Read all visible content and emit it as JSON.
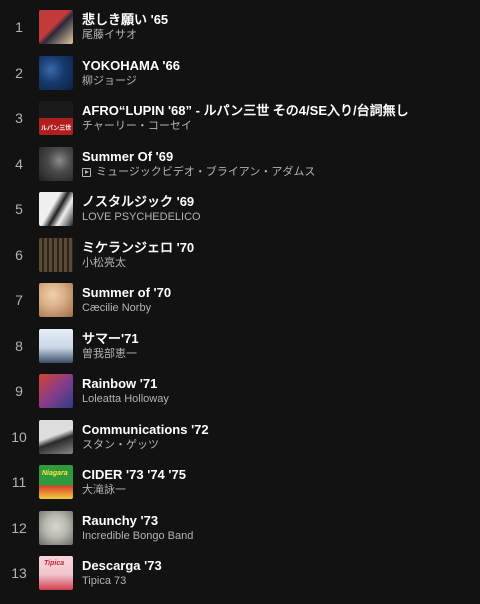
{
  "tracks": [
    {
      "num": "1",
      "title": "悲しき願い '65",
      "artist": "尾藤イサオ",
      "video": false,
      "cover_colors": [
        "#c23a3a",
        "#2a2a3a"
      ]
    },
    {
      "num": "2",
      "title": "YOKOHAMA '66",
      "artist": "柳ジョージ",
      "video": false,
      "cover_colors": [
        "#163a6e",
        "#0b2242"
      ]
    },
    {
      "num": "3",
      "title": "AFRO“LUPIN '68” - ルパン三世 その4/SE入り/台詞無し",
      "artist": "チャーリー・コーセイ",
      "video": false,
      "cover_colors": [
        "#1a1a1a",
        "#b01e1e"
      ]
    },
    {
      "num": "4",
      "title": "Summer Of '69",
      "artist": "ミュージックビデオ・ブライアン・アダムス",
      "video": true,
      "cover_colors": [
        "#4a4a4a",
        "#1f1f1f"
      ]
    },
    {
      "num": "5",
      "title": "ノスタルジック '69",
      "artist": "LOVE PSYCHEDELICO",
      "video": false,
      "cover_colors": [
        "#e8e8e8",
        "#202020"
      ]
    },
    {
      "num": "6",
      "title": "ミケランジェロ '70",
      "artist": "小松亮太",
      "video": false,
      "cover_colors": [
        "#5a4a36",
        "#2b231a"
      ]
    },
    {
      "num": "7",
      "title": "Summer of '70",
      "artist": "Cæcilie Norby",
      "video": false,
      "cover_colors": [
        "#d9b08a",
        "#a06a48"
      ]
    },
    {
      "num": "8",
      "title": "サマー'71",
      "artist": "曽我部恵一",
      "video": false,
      "cover_colors": [
        "#c9d6e6",
        "#3c4e66"
      ]
    },
    {
      "num": "9",
      "title": "Rainbow '71",
      "artist": "Loleatta Holloway",
      "video": false,
      "cover_colors": [
        "#8a3c8a",
        "#d2452f"
      ]
    },
    {
      "num": "10",
      "title": "Communications '72",
      "artist": "スタン・ゲッツ",
      "video": false,
      "cover_colors": [
        "#dedede",
        "#2a2a2a"
      ]
    },
    {
      "num": "11",
      "title": "CIDER '73 '74 '75",
      "artist": "大滝詠一",
      "video": false,
      "cover_colors": [
        "#2f9a3c",
        "#d83a2a"
      ]
    },
    {
      "num": "12",
      "title": "Raunchy '73",
      "artist": "Incredible Bongo Band",
      "video": false,
      "cover_colors": [
        "#b8b8b0",
        "#6a6a64"
      ]
    },
    {
      "num": "13",
      "title": "Descarga '73",
      "artist": "Tipica 73",
      "video": false,
      "cover_colors": [
        "#f2c4cc",
        "#d04050"
      ]
    }
  ],
  "cover_texts": {
    "3": "ルパン三世",
    "11": "Niagara",
    "13": "Tipica"
  }
}
